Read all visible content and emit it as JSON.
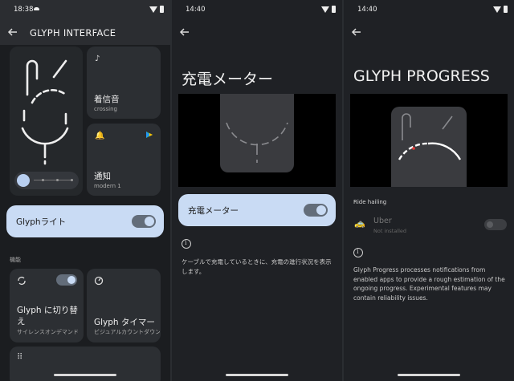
{
  "screen1": {
    "status_time": "18:38",
    "title": "GLYPH INTERFACE",
    "ringtone": {
      "label": "着信音",
      "value": "crossing"
    },
    "notification": {
      "label": "通知",
      "value": "modern 1"
    },
    "glyph_light": {
      "label": "Glyphライト",
      "on": true
    },
    "section_features": "機能",
    "flip_to_glyph": {
      "label": "Glyph に切り替え",
      "sub": "サイレンスオンデマンド"
    },
    "glyph_timer": {
      "label": "Glyph タイマー",
      "sub": "ビジュアルカウントダウン"
    }
  },
  "screen2": {
    "status_time": "14:40",
    "title": "充電メーター",
    "toggle_label": "充電メーター",
    "toggle_on": true,
    "description": "ケーブルで充電しているときに、充電の進行状況を表示します。"
  },
  "screen3": {
    "status_time": "14:40",
    "title": "GLYPH PROGRESS",
    "section": "Ride hailing",
    "app_name": "Uber",
    "app_status": "Not installed",
    "description": "Glyph Progress processes notifications from enabled apps to provide a rough estimation of the ongoing progress. Experimental features may contain reliability issues."
  },
  "colors": {
    "accent": "#c9dbf4",
    "background": "#1f2125",
    "card": "#2c2f33"
  },
  "icons": [
    "back-arrow-icon",
    "music-note-icon",
    "bell-icon",
    "brightness-icon",
    "flip-icon",
    "timer-icon",
    "grid-icon",
    "info-icon",
    "car-icon",
    "play-store-icon"
  ]
}
